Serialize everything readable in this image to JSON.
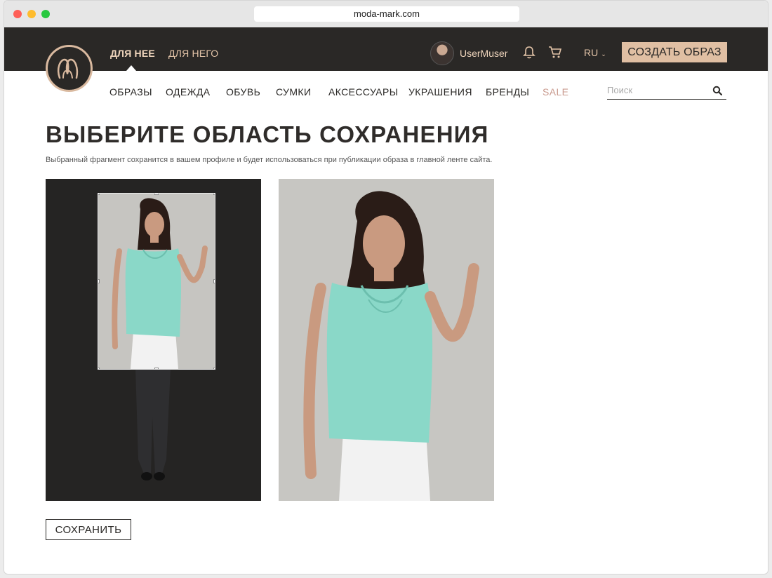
{
  "browser": {
    "url": "moda-mark.com"
  },
  "header": {
    "gender_tabs": [
      "ДЛЯ НЕЕ",
      "ДЛЯ НЕГО"
    ],
    "username": "UserMuser",
    "lang": "RU",
    "create_button": "СОЗДАТЬ ОБРАЗ",
    "icons": [
      "bell-icon",
      "cart-icon"
    ]
  },
  "nav": {
    "categories": [
      "ОБРАЗЫ",
      "ОДЕЖДА",
      "ОБУВЬ",
      "СУМКИ",
      "АКСЕССУАРЫ",
      "УКРАШЕНИЯ",
      "БРЕНДЫ",
      "SALE"
    ],
    "search_placeholder": "Поиск"
  },
  "main": {
    "title": "ВЫБЕРИТЕ ОБЛАСТЬ СОХРАНЕНИЯ",
    "subtitle": "Выбранный фрагмент сохранится в вашем профиле и будет использоваться при публикации образа в главной ленте сайта.",
    "save_button": "СОХРАНИТЬ"
  },
  "colors": {
    "header_bg": "#2a2826",
    "accent": "#e0bfa3",
    "sale": "#c99a8e",
    "blouse": "#8ad8c8"
  }
}
